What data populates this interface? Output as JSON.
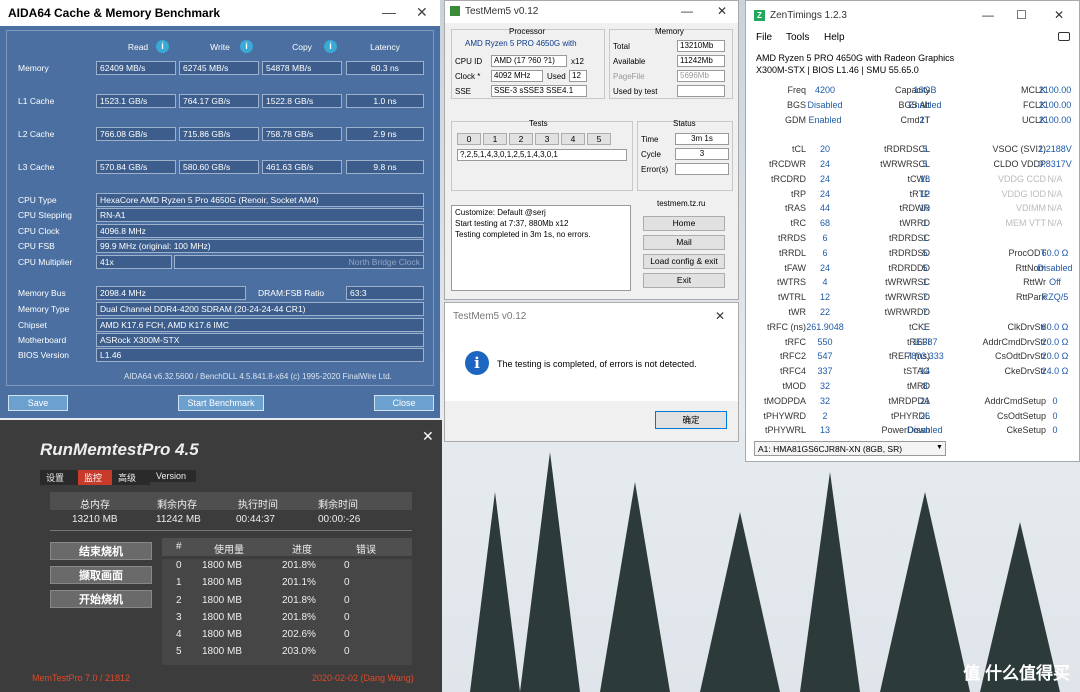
{
  "aida": {
    "title": "AIDA64 Cache & Memory Benchmark",
    "min": "—",
    "close": "✕",
    "cols": [
      "Read",
      "Write",
      "Copy",
      "Latency"
    ],
    "rows": [
      {
        "label": "Memory",
        "read": "62409 MB/s",
        "write": "62745 MB/s",
        "copy": "54878 MB/s",
        "lat": "60.3 ns"
      },
      {
        "label": "L1 Cache",
        "read": "1523.1 GB/s",
        "write": "764.17 GB/s",
        "copy": "1522.8 GB/s",
        "lat": "1.0 ns"
      },
      {
        "label": "L2 Cache",
        "read": "766.08 GB/s",
        "write": "715.86 GB/s",
        "copy": "758.78 GB/s",
        "lat": "2.9 ns"
      },
      {
        "label": "L3 Cache",
        "read": "570.84 GB/s",
        "write": "580.60 GB/s",
        "copy": "461.63 GB/s",
        "lat": "9.8 ns"
      }
    ],
    "cpu_type_l": "CPU Type",
    "cpu_type": "HexaCore AMD Ryzen 5 Pro 4650G  (Renoir, Socket AM4)",
    "cpu_step_l": "CPU Stepping",
    "cpu_step": "RN-A1",
    "cpu_clock_l": "CPU Clock",
    "cpu_clock": "4096.8 MHz",
    "cpu_fsb_l": "CPU FSB",
    "cpu_fsb": "99.9 MHz  (original: 100 MHz)",
    "cpu_mult_l": "CPU Multiplier",
    "cpu_mult": "41x",
    "nb_clock": "North Bridge Clock",
    "mem_bus_l": "Memory Bus",
    "mem_bus": "2098.4 MHz",
    "dram_ratio_l": "DRAM:FSB Ratio",
    "dram_ratio": "63:3",
    "mem_type_l": "Memory Type",
    "mem_type": "Dual Channel DDR4-4200 SDRAM  (20-24-24-44 CR1)",
    "chipset_l": "Chipset",
    "chipset": "AMD K17.6 FCH, AMD K17.6 IMC",
    "mb_l": "Motherboard",
    "mb": "ASRock X300M-STX",
    "bios_l": "BIOS Version",
    "bios": "L1.46",
    "footer": "AIDA64 v6.32.5600 / BenchDLL 4.5.841.8-x64  (c) 1995-2020 FinalWire Ltd.",
    "save": "Save",
    "start": "Start Benchmark",
    "close_btn": "Close"
  },
  "rmt": {
    "title": "RunMemtestPro 4.5",
    "close": "✕",
    "tabs": [
      "设置",
      "监控",
      "高级",
      "Version"
    ],
    "h1": "总内存",
    "h2": "剩余内存",
    "h3": "执行时间",
    "h4": "剩余时间",
    "v1": "13210 MB",
    "v2": "11242 MB",
    "v3": "00:44:37",
    "v4": "00:00:-26",
    "b1": "结束烧机",
    "b2": "撷取画面",
    "b3": "开始烧机",
    "th": [
      "#",
      "使用量",
      "进度",
      "错误"
    ],
    "rows": [
      [
        "0",
        "1800 MB",
        "201.8%",
        "0"
      ],
      [
        "1",
        "1800 MB",
        "201.1%",
        "0"
      ],
      [
        "2",
        "1800 MB",
        "201.8%",
        "0"
      ],
      [
        "3",
        "1800 MB",
        "201.8%",
        "0"
      ],
      [
        "4",
        "1800 MB",
        "202.6%",
        "0"
      ],
      [
        "5",
        "1800 MB",
        "203.0%",
        "0"
      ]
    ],
    "footer_l": "MemTestPro 7.0 / 21812",
    "footer_r": "2020-02-02 (Dang Wang)"
  },
  "tm5": {
    "title": "TestMem5 v0.12",
    "close": "✕",
    "min": "—",
    "processor": "Processor",
    "cpu": "AMD Ryzen 5 PRO 4650G with",
    "cpuid_l": "CPU ID",
    "cpuid": "AMD  (17 ?60 ?1)",
    "cpuid_x": "x12",
    "clock_l": "Clock *",
    "clock": "4092 MHz",
    "used_l": "Used",
    "used": "12",
    "sse_l": "SSE",
    "sse": "SSE-3 sSSE3 SSE4.1",
    "memory": "Memory",
    "total_l": "Total",
    "total": "13210Mb",
    "avail_l": "Available",
    "avail": "11242Mb",
    "pf_l": "PageFile",
    "pf": "5696Mb",
    "ubt_l": "Used by test",
    "tests": "Tests",
    "tnums": [
      "0",
      "1",
      "2",
      "3",
      "4",
      "5"
    ],
    "tseq": "?,2,5,1,4,3,0,1,2,5,1,4,3,0,1",
    "status": "Status",
    "time_l": "Time",
    "time": "3m 1s",
    "cycle_l": "Cycle",
    "cycle": "3",
    "err_l": "Error(s)",
    "log": [
      "Customize: Default @serj",
      "Start testing at 7:37, 880Mb x12",
      "Testing completed in 3m 1s, no errors."
    ],
    "site": "testmem.tz.ru",
    "home": "Home",
    "mail": "Mail",
    "load": "Load config & exit",
    "exit": "Exit"
  },
  "dlg": {
    "title": "TestMem5 v0.12",
    "close": "✕",
    "msg": "The testing is completed, of errors is not detected.",
    "ok": "确定",
    "icon": "i"
  },
  "zen": {
    "title": "ZenTimings 1.2.3",
    "min": "—",
    "max": "☐",
    "close": "✕",
    "menu": [
      "File",
      "Tools",
      "Help"
    ],
    "cpu": "AMD Ryzen 5 PRO 4650G with Radeon Graphics",
    "board": "X300M-STX | BIOS L1.46 | SMU 55.65.0",
    "c1": [
      [
        "Freq",
        "4200"
      ],
      [
        "BGS",
        "Disabled"
      ],
      [
        "GDM",
        "Enabled"
      ],
      [
        "",
        ""
      ],
      [
        "tCL",
        "20"
      ],
      [
        "tRCDWR",
        "24"
      ],
      [
        "tRCDRD",
        "24"
      ],
      [
        "tRP",
        "24"
      ],
      [
        "tRAS",
        "44"
      ],
      [
        "tRC",
        "68"
      ],
      [
        "tRRDS",
        "6"
      ],
      [
        "tRRDL",
        "6"
      ],
      [
        "tFAW",
        "24"
      ],
      [
        "tWTRS",
        "4"
      ],
      [
        "tWTRL",
        "12"
      ],
      [
        "tWR",
        "22"
      ],
      [
        "tRFC (ns)",
        "261.9048"
      ],
      [
        "tRFC",
        "550"
      ],
      [
        "tRFC2",
        "547"
      ],
      [
        "tRFC4",
        "337"
      ],
      [
        "tMOD",
        "32"
      ],
      [
        "tMODPDA",
        "32"
      ],
      [
        "tPHYWRD",
        "2"
      ],
      [
        "tPHYWRL",
        "13"
      ]
    ],
    "c2": [
      [
        "Capacity",
        "16GB"
      ],
      [
        "BGS Alt",
        "Enabled"
      ],
      [
        "Cmd2T",
        "1T"
      ],
      [
        "",
        ""
      ],
      [
        "tRDRDSCL",
        "5"
      ],
      [
        "tWRWRSCL",
        "5"
      ],
      [
        "tCWL",
        "18"
      ],
      [
        "tRTP",
        "12"
      ],
      [
        "tRDWR",
        "10"
      ],
      [
        "tWRRD",
        "1"
      ],
      [
        "tRDRDSC",
        "1"
      ],
      [
        "tRDRDSD",
        "5"
      ],
      [
        "tRDRDDD",
        "5"
      ],
      [
        "tWRWRSC",
        "1"
      ],
      [
        "tWRWRSD",
        "7"
      ],
      [
        "tWRWRDD",
        "7"
      ],
      [
        "tCKE",
        "1"
      ],
      [
        "tREFI",
        "16387"
      ],
      [
        "tREFI (ns)",
        "7803.333"
      ],
      [
        "tSTAG",
        "14"
      ],
      [
        "tMRD",
        "8"
      ],
      [
        "tMRDPDA",
        "21"
      ],
      [
        "tPHYRDL",
        "26"
      ],
      [
        "PowerDown",
        "Disabled"
      ]
    ],
    "c3": [
      [
        "MCLK",
        "2100.00"
      ],
      [
        "FCLK",
        "2100.00"
      ],
      [
        "UCLK",
        "2100.00"
      ],
      [
        "",
        ""
      ],
      [
        "VSOC (SVI2)",
        "1.2188V"
      ],
      [
        "CLDO VDDP",
        "0.8317V"
      ],
      [
        "VDDG CCD",
        "N/A"
      ],
      [
        "VDDG IOD",
        "N/A"
      ],
      [
        "VDIMM",
        "N/A"
      ],
      [
        "MEM VTT",
        "N/A"
      ],
      [
        "",
        ""
      ],
      [
        "ProcODT",
        "60.0 Ω"
      ],
      [
        "RttNom",
        "Disabled"
      ],
      [
        "RttWr",
        "Off"
      ],
      [
        "RttPark",
        "RZQ/5"
      ],
      [
        "",
        ""
      ],
      [
        "ClkDrvStr",
        "60.0 Ω"
      ],
      [
        "AddrCmdDrvStr",
        "20.0 Ω"
      ],
      [
        "CsOdtDrvStr",
        "20.0 Ω"
      ],
      [
        "CkeDrvStr",
        "24.0 Ω"
      ],
      [
        "",
        ""
      ],
      [
        "AddrCmdSetup",
        "0"
      ],
      [
        "CsOdtSetup",
        "0"
      ],
      [
        "CkeSetup",
        "0"
      ]
    ],
    "dimm": "A1: HMA81GS6CJR8N-XN (8GB, SR)"
  },
  "brand": "值 什么值得买"
}
